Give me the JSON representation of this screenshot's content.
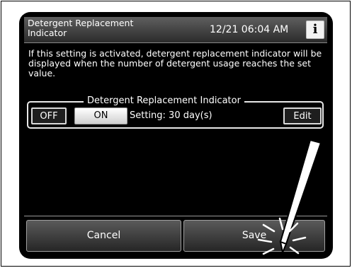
{
  "header": {
    "title": "Detergent Replacement Indicator",
    "clock": "12/21 06:04 AM",
    "info_label": "i"
  },
  "description": "If this setting is activated, detergent replacement indicator will be displayed when the number of detergent usage reaches the set value.",
  "indicator_group": {
    "legend": "Detergent Replacement Indicator",
    "off_label": "OFF",
    "on_label": "ON",
    "selected": "ON",
    "setting_text": "Setting: 30 day(s)",
    "edit_label": "Edit"
  },
  "footer": {
    "cancel_label": "Cancel",
    "save_label": "Save"
  },
  "colors": {
    "screen_background": "#000000",
    "header_gradient_top": "#5f5f5f",
    "header_gradient_bottom": "#2b2b2b",
    "text": "#ffffff",
    "selected_button": "#e6e6e6"
  },
  "icons": {
    "info": "info-icon",
    "stylus": "stylus-pointer-icon",
    "tap": "tap-burst-icon"
  }
}
